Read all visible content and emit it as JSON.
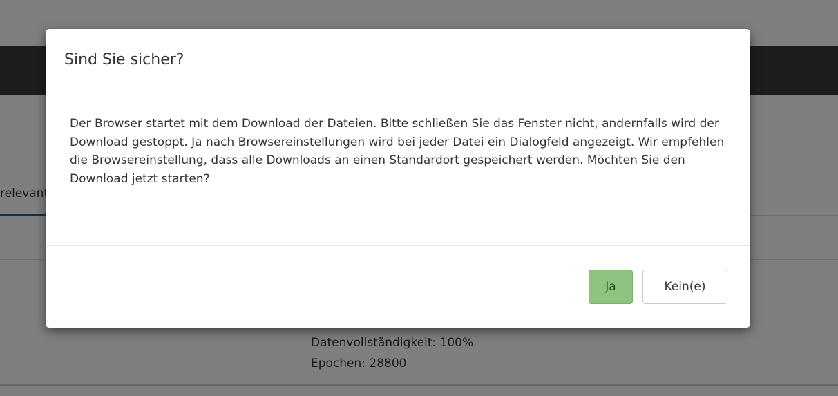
{
  "background": {
    "tab_label": "relevant",
    "detail_lines": [
      "Datenvollständigkeit: 100%",
      "Epochen: 28800"
    ]
  },
  "modal": {
    "title": "Sind Sie sicher?",
    "body": "Der Browser startet mit dem Download der Dateien. Bitte schließen Sie das Fenster nicht, andernfalls wird der Download gestoppt. Ja nach Browsereinstellungen wird bei jeder Datei ein Dialogfeld angezeigt. Wir empfehlen die Browsereinstellung, dass alle Downloads an einen Standardort gespeichert werden. Möchten Sie den Download jetzt starten?",
    "yes_label": "Ja",
    "no_label": "Kein(e)"
  },
  "colors": {
    "backdrop": "rgba(0,0,0,0.5)",
    "navbar": "#3b3b3b",
    "yes_button": "#8dc47f",
    "tab_active": "#3b5f7c"
  }
}
